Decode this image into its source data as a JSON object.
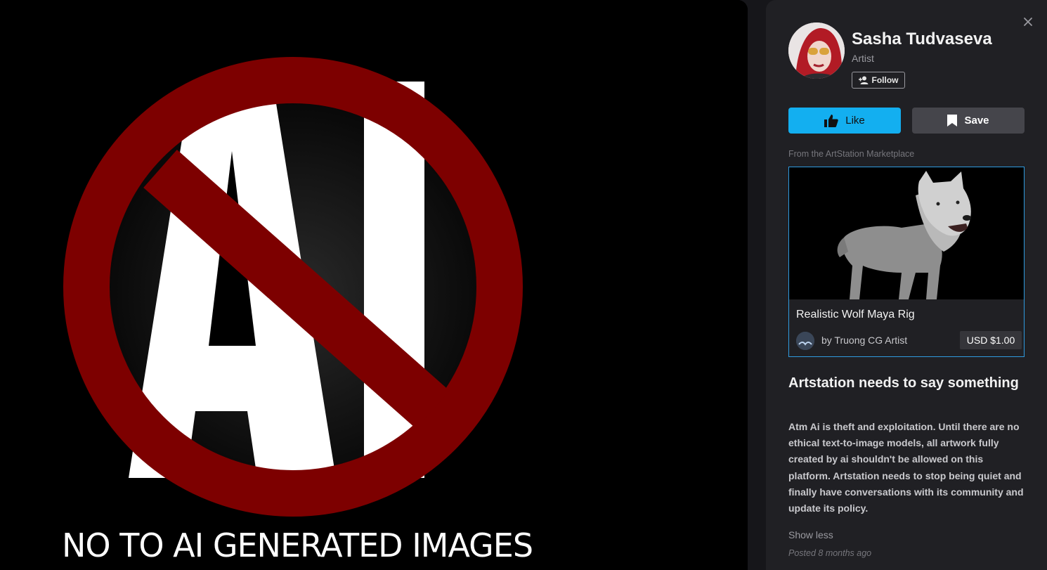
{
  "artwork": {
    "caption": "NO TO AI GENERATED IMAGES",
    "big_letters": "AI"
  },
  "artist": {
    "name": "Sasha Tudvaseva",
    "role": "Artist",
    "follow_label": "Follow"
  },
  "actions": {
    "like_label": "Like",
    "save_label": "Save"
  },
  "marketplace": {
    "label": "From the ArtStation Marketplace",
    "product_title": "Realistic Wolf Maya Rig",
    "seller": "by Truong CG Artist",
    "price": "USD $1.00"
  },
  "description": {
    "title": "Artstation needs to say something",
    "body": "Atm Ai is theft and exploitation. Until there are no ethical text-to-image models, all artwork fully created by ai shouldn't be allowed on this platform. Artstation needs to stop being quiet and finally have conversations with its community and update its policy.",
    "show_less": "Show less",
    "posted": "Posted 8 months ago"
  },
  "colors": {
    "accent": "#13aff0",
    "prohibition_red": "#7d0000",
    "panel_bg": "#202024",
    "card_border": "#2f9be0"
  },
  "icons": [
    "close-icon",
    "add-user-icon",
    "thumbs-up-icon",
    "bookmark-icon"
  ]
}
